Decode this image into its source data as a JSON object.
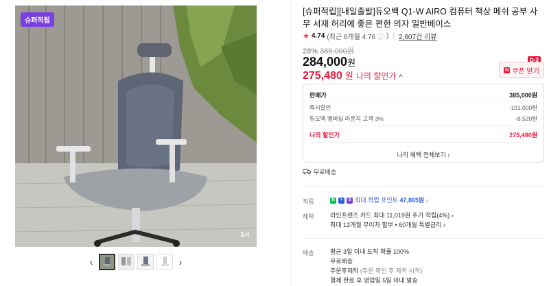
{
  "gallery": {
    "badge": "슈퍼적립",
    "counter_current": "1",
    "counter_total": "/4",
    "prev_icon": "‹",
    "next_icon": "›"
  },
  "product": {
    "title": "[슈퍼적립][내일출발]듀오백 Q1-W AIRO 컴퓨터 책상 메쉬 공부 사무 서재 허리에 좋은 편한 의자 일반베이스",
    "rating_score": "4.74",
    "rating_recent": "(최근 6개월 4.76",
    "rating_info_icon": "ⓘ",
    "rating_recent_close": ")",
    "review_count": "2,607건 리뷰",
    "discount_pct": "28%",
    "original_price": "385,000원",
    "price": "284,000",
    "price_unit": "원",
    "my_price": "275,480",
    "my_price_unit": "원",
    "my_price_label": "나의 할인가",
    "my_price_chevron": "^"
  },
  "coupon": {
    "dday": "D-3",
    "icon_text": "N",
    "label": "쿠폰 받기"
  },
  "price_box": {
    "head_label": "판매가",
    "head_value": "385,000원",
    "rows": [
      {
        "label": "즉시할인",
        "value": "-101,000원"
      },
      {
        "label": "듀오백 멤버십 라운지 고객 3%",
        "value": "-8,520원"
      }
    ],
    "mine_label": "나의 할인가",
    "mine_value": "275,480원",
    "more": "나의 혜택 전체보기 ›"
  },
  "shipping_free": "무료배송",
  "benefits": {
    "point_label": "적립",
    "point_text_prefix": "최대 적립 포인트",
    "point_amount": "47,865원",
    "point_chevron": "›",
    "benefit_label": "혜택",
    "benefit_line1": "라인프렌즈 카드 최대 11,019원 추가 적립(4%) ›",
    "benefit_line2": "최대 12개월 무이자 할부 • 60개월 특별금리 ›"
  },
  "delivery": {
    "label": "배송",
    "line1": "평균 3일 이내 도착 확률 100%",
    "line2": "무료배송",
    "line3_main": "주문후제작",
    "line3_note": "(주문 확인 후 제작 시작)",
    "line4": "결제 완료 후 영업일 5일 이내 발송"
  },
  "colors": {
    "accent_red": "#e8193c",
    "badge_purple": "#7b3fe4",
    "point_blue": "#2f5fd8",
    "naverpay_green": "#03c75a"
  }
}
